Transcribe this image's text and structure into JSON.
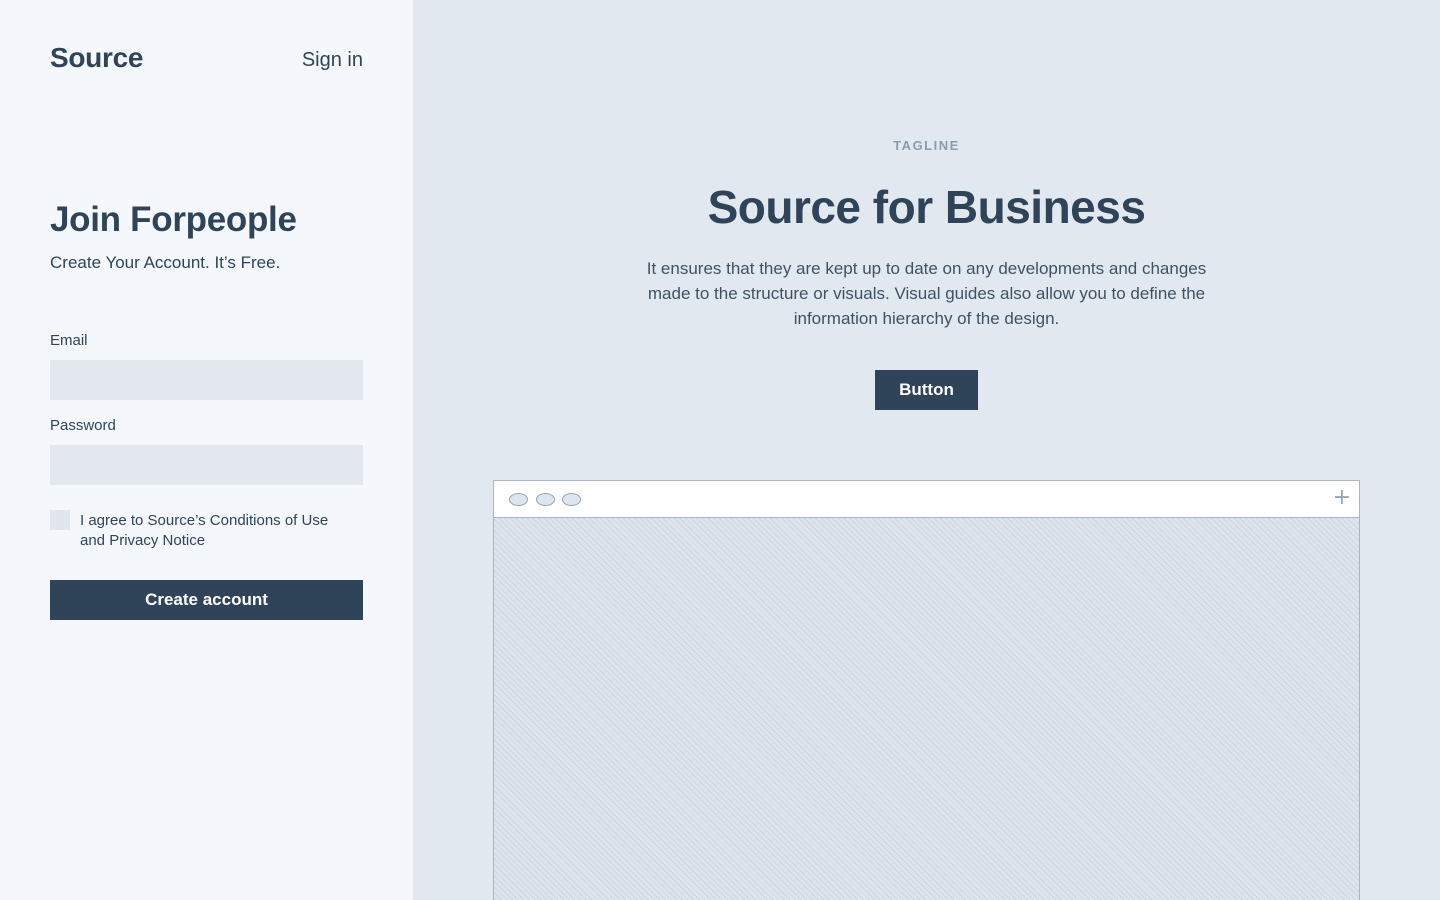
{
  "brand": "Source",
  "header": {
    "signin_label": "Sign in"
  },
  "signup": {
    "title": "Join Forpeople",
    "subtitle": "Create Your Account. It’s Free.",
    "email_label": "Email",
    "email_value": "",
    "password_label": "Password",
    "password_value": "",
    "agree_checked": false,
    "agree_text": "I agree to Source’s Conditions of Use and Privacy Notice",
    "create_label": "Create account"
  },
  "hero": {
    "tagline": "TAGLINE",
    "title": "Source for Business",
    "description": "It ensures that they are kept up to date on any developments and changes made to the structure or visuals. Visual guides also allow you to define the information hierarchy of the design.",
    "button_label": "Button"
  },
  "browser_mock": {
    "window_dots": [
      "close-dot",
      "minimize-dot",
      "maximize-dot"
    ],
    "new_tab_icon": "plus-icon",
    "new_tab_glyph": "+"
  },
  "colors": {
    "primary": "#2f4459",
    "left_bg": "#f4f7fb",
    "right_bg": "#e1e8ef",
    "input_bg": "#e3e8ef",
    "muted": "#8a9cb0"
  }
}
